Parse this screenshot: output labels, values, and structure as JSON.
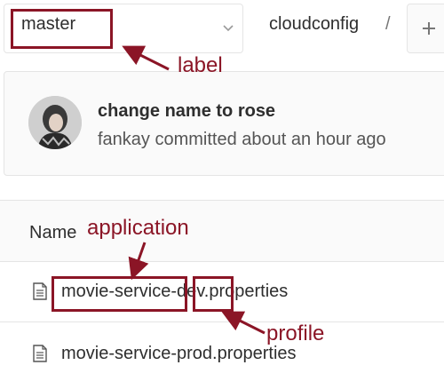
{
  "toolbar": {
    "branch": "master",
    "repo": "cloudconfig",
    "separator": "/"
  },
  "commit": {
    "title": "change name to rose",
    "meta": "fankay committed about an hour ago"
  },
  "table": {
    "header_name": "Name",
    "files": [
      {
        "name": "movie-service-dev.properties"
      },
      {
        "name": "movie-service-prod.properties"
      }
    ]
  },
  "annotations": {
    "label": "label",
    "application": "application",
    "profile": "profile",
    "color": "#8b1526"
  },
  "icons": {
    "branch_dropdown": "chevron-down-icon",
    "add": "plus-icon",
    "file": "file-text-icon"
  }
}
